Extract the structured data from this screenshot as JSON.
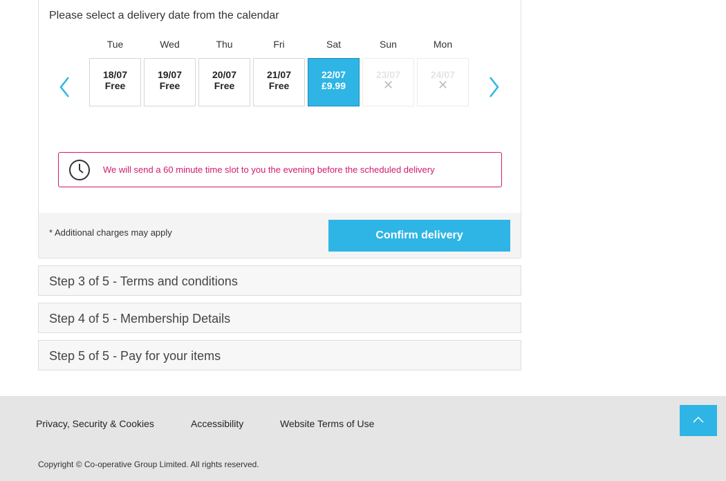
{
  "delivery": {
    "instruction": "Please select a delivery date from the calendar",
    "days": [
      {
        "name": "Tue",
        "date": "18/07",
        "price": "Free",
        "state": "normal"
      },
      {
        "name": "Wed",
        "date": "19/07",
        "price": "Free",
        "state": "normal"
      },
      {
        "name": "Thu",
        "date": "20/07",
        "price": "Free",
        "state": "normal"
      },
      {
        "name": "Fri",
        "date": "21/07",
        "price": "Free",
        "state": "normal"
      },
      {
        "name": "Sat",
        "date": "22/07",
        "price": "£9.99",
        "state": "selected"
      },
      {
        "name": "Sun",
        "date": "23/07",
        "price": "✕",
        "state": "disabled"
      },
      {
        "name": "Mon",
        "date": "24/07",
        "price": "✕",
        "state": "disabled"
      }
    ],
    "prev_icon": "chevron-left-icon",
    "next_icon": "chevron-right-icon",
    "notice": "We will send a 60 minute time slot to you the evening before the scheduled delivery",
    "notice_icon": "clock-icon",
    "charges_note": "* Additional charges may apply",
    "confirm_label": "Confirm delivery"
  },
  "steps": [
    "Step 3 of 5 - Terms and conditions",
    "Step 4 of 5 - Membership Details",
    "Step 5 of 5 - Pay for your items"
  ],
  "footer": {
    "links": [
      "Privacy, Security & Cookies",
      "Accessibility",
      "Website Terms of Use"
    ],
    "copyright": "Copyright © Co-operative Group Limited. All rights reserved.",
    "to_top_icon": "chevron-up-icon"
  },
  "colors": {
    "accent": "#2eb5e5",
    "notice": "#d3196e"
  }
}
